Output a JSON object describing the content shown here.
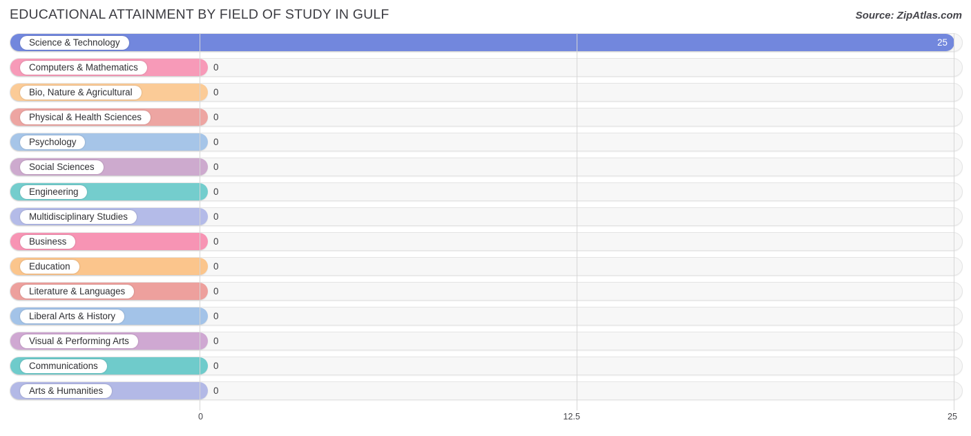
{
  "header": {
    "title": "EDUCATIONAL ATTAINMENT BY FIELD OF STUDY IN GULF",
    "source": "Source: ZipAtlas.com"
  },
  "chart_data": {
    "type": "bar",
    "orientation": "horizontal",
    "title": "EDUCATIONAL ATTAINMENT BY FIELD OF STUDY IN GULF",
    "xlabel": "",
    "ylabel": "",
    "xlim": [
      0,
      25
    ],
    "grid": true,
    "legend": "none",
    "ticks": [
      "0",
      "12.5",
      "25"
    ],
    "tick_values": [
      0,
      12.5,
      25
    ],
    "categories": [
      "Science & Technology",
      "Computers & Mathematics",
      "Bio, Nature & Agricultural",
      "Physical & Health Sciences",
      "Psychology",
      "Social Sciences",
      "Engineering",
      "Multidisciplinary Studies",
      "Business",
      "Education",
      "Literature & Languages",
      "Liberal Arts & History",
      "Visual & Performing Arts",
      "Communications",
      "Arts & Humanities"
    ],
    "values": [
      25,
      0,
      0,
      0,
      0,
      0,
      0,
      0,
      0,
      0,
      0,
      0,
      0,
      0,
      0
    ],
    "value_labels": [
      "25",
      "0",
      "0",
      "0",
      "0",
      "0",
      "0",
      "0",
      "0",
      "0",
      "0",
      "0",
      "0",
      "0",
      "0"
    ],
    "colors": [
      "#7287dd",
      "#f79ab8",
      "#fbcb97",
      "#eda5a2",
      "#a6c5e8",
      "#cdaace",
      "#74cdcd",
      "#b4bbe8",
      "#f794b4",
      "#fbc58c",
      "#eda09d",
      "#a3c3e8",
      "#cfa8d2",
      "#6fcbcb",
      "#b3b9e6"
    ]
  }
}
